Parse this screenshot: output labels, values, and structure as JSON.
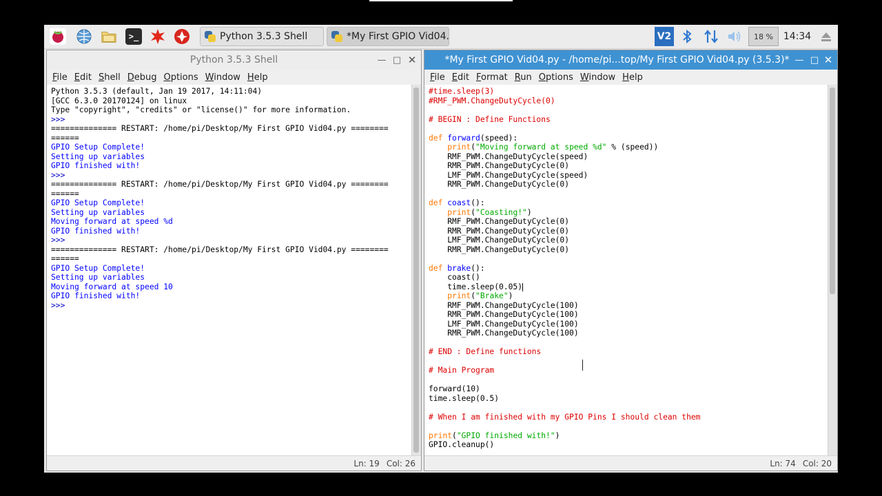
{
  "taskbar": {
    "launchers": [
      "raspberry-menu",
      "web-browser",
      "file-manager",
      "terminal",
      "math-kernel",
      "wolfram"
    ],
    "tasks": [
      {
        "label": "Python 3.5.3 Shell",
        "active": false
      },
      {
        "label": "*My First GPIO Vid04...",
        "active": true
      }
    ],
    "tray": {
      "vnc": "V2",
      "cpu": "18 %",
      "clock": "14:34"
    }
  },
  "shell": {
    "title": "Python 3.5.3 Shell",
    "menus": [
      "File",
      "Edit",
      "Shell",
      "Debug",
      "Options",
      "Window",
      "Help"
    ],
    "lines": [
      {
        "t": "Python 3.5.3 (default, Jan 19 2017, 14:11:04)",
        "c": ""
      },
      {
        "t": "[GCC 6.3.0 20170124] on linux",
        "c": ""
      },
      {
        "t": "Type \"copyright\", \"credits\" or \"license()\" for more information.",
        "c": ""
      },
      {
        "t": ">>> ",
        "c": "c-out"
      },
      {
        "t": "============== RESTART: /home/pi/Desktop/My First GPIO Vid04.py ========",
        "c": ""
      },
      {
        "t": "======",
        "c": ""
      },
      {
        "t": "GPIO Setup Complete!",
        "c": "c-stdout"
      },
      {
        "t": "Setting up variables",
        "c": "c-stdout"
      },
      {
        "t": "GPIO finished with!",
        "c": "c-stdout"
      },
      {
        "t": ">>> ",
        "c": "c-out"
      },
      {
        "t": "============== RESTART: /home/pi/Desktop/My First GPIO Vid04.py ========",
        "c": ""
      },
      {
        "t": "======",
        "c": ""
      },
      {
        "t": "GPIO Setup Complete!",
        "c": "c-stdout"
      },
      {
        "t": "Setting up variables",
        "c": "c-stdout"
      },
      {
        "t": "Moving forward at speed %d",
        "c": "c-stdout"
      },
      {
        "t": "GPIO finished with!",
        "c": "c-stdout"
      },
      {
        "t": ">>> ",
        "c": "c-out"
      },
      {
        "t": "============== RESTART: /home/pi/Desktop/My First GPIO Vid04.py ========",
        "c": ""
      },
      {
        "t": "======",
        "c": ""
      },
      {
        "t": "GPIO Setup Complete!",
        "c": "c-stdout"
      },
      {
        "t": "Setting up variables",
        "c": "c-stdout"
      },
      {
        "t": "Moving forward at speed 10",
        "c": "c-stdout"
      },
      {
        "t": "GPIO finished with!",
        "c": "c-stdout"
      },
      {
        "t": ">>> ",
        "c": "c-out"
      }
    ],
    "status": {
      "ln": "Ln: 19",
      "col": "Col: 26"
    }
  },
  "editor": {
    "title": "*My First GPIO Vid04.py - /home/pi...top/My First GPIO Vid04.py (3.5.3)*",
    "menus": [
      "File",
      "Edit",
      "Format",
      "Run",
      "Options",
      "Window",
      "Help"
    ],
    "lines": [
      [
        {
          "t": "#time.sleep(3)",
          "c": "c-cmt"
        }
      ],
      [
        {
          "t": "#RMF_PWM.ChangeDutyCycle(0)",
          "c": "c-cmt"
        }
      ],
      [],
      [
        {
          "t": "# BEGIN : Define Functions",
          "c": "c-cmt"
        }
      ],
      [],
      [
        {
          "t": "def ",
          "c": "c-def"
        },
        {
          "t": "forward",
          "c": "c-fn"
        },
        {
          "t": "(speed):",
          "c": ""
        }
      ],
      [
        {
          "t": "    ",
          "c": ""
        },
        {
          "t": "print",
          "c": "c-def"
        },
        {
          "t": "(",
          "c": ""
        },
        {
          "t": "\"Moving forward at speed %d\"",
          "c": "c-str"
        },
        {
          "t": " % (speed))",
          "c": ""
        }
      ],
      [
        {
          "t": "    RMF_PWM.ChangeDutyCycle(speed)",
          "c": ""
        }
      ],
      [
        {
          "t": "    RMR_PWM.ChangeDutyCycle(0)",
          "c": ""
        }
      ],
      [
        {
          "t": "    LMF_PWM.ChangeDutyCycle(speed)",
          "c": ""
        }
      ],
      [
        {
          "t": "    RMR_PWM.ChangeDutyCycle(0)",
          "c": ""
        }
      ],
      [],
      [
        {
          "t": "def ",
          "c": "c-def"
        },
        {
          "t": "coast",
          "c": "c-fn"
        },
        {
          "t": "():",
          "c": ""
        }
      ],
      [
        {
          "t": "    ",
          "c": ""
        },
        {
          "t": "print",
          "c": "c-def"
        },
        {
          "t": "(",
          "c": ""
        },
        {
          "t": "\"Coasting!\"",
          "c": "c-str"
        },
        {
          "t": ")",
          "c": ""
        }
      ],
      [
        {
          "t": "    RMF_PWM.ChangeDutyCycle(0)",
          "c": ""
        }
      ],
      [
        {
          "t": "    RMR_PWM.ChangeDutyCycle(0)",
          "c": ""
        }
      ],
      [
        {
          "t": "    LMF_PWM.ChangeDutyCycle(0)",
          "c": ""
        }
      ],
      [
        {
          "t": "    RMR_PWM.ChangeDutyCycle(0)",
          "c": ""
        }
      ],
      [],
      [
        {
          "t": "def ",
          "c": "c-def"
        },
        {
          "t": "brake",
          "c": "c-fn"
        },
        {
          "t": "():",
          "c": ""
        }
      ],
      [
        {
          "t": "    coast()",
          "c": ""
        }
      ],
      [
        {
          "t": "    time.sleep(0.05)",
          "c": ""
        },
        {
          "t": "",
          "c": "cursor"
        }
      ],
      [
        {
          "t": "    ",
          "c": ""
        },
        {
          "t": "print",
          "c": "c-def"
        },
        {
          "t": "(",
          "c": ""
        },
        {
          "t": "\"Brake\"",
          "c": "c-str"
        },
        {
          "t": ")",
          "c": ""
        }
      ],
      [
        {
          "t": "    RMF_PWM.ChangeDutyCycle(100)",
          "c": ""
        }
      ],
      [
        {
          "t": "    RMR_PWM.ChangeDutyCycle(100)",
          "c": ""
        }
      ],
      [
        {
          "t": "    LMF_PWM.ChangeDutyCycle(100)",
          "c": ""
        }
      ],
      [
        {
          "t": "    RMR_PWM.ChangeDutyCycle(100)",
          "c": ""
        }
      ],
      [],
      [
        {
          "t": "# END : Define functions",
          "c": "c-cmt"
        }
      ],
      [],
      [
        {
          "t": "# Main Program",
          "c": "c-cmt"
        }
      ],
      [],
      [
        {
          "t": "forward(10)",
          "c": ""
        }
      ],
      [
        {
          "t": "time.sleep(0.5)",
          "c": ""
        }
      ],
      [],
      [
        {
          "t": "# When I am finished with my GPIO Pins I should clean them",
          "c": "c-cmt"
        }
      ],
      [],
      [
        {
          "t": "print",
          "c": "c-def"
        },
        {
          "t": "(",
          "c": ""
        },
        {
          "t": "\"GPIO finished with!\"",
          "c": "c-str"
        },
        {
          "t": ")",
          "c": ""
        }
      ],
      [
        {
          "t": "GPIO.cleanup()",
          "c": ""
        }
      ]
    ],
    "status": {
      "ln": "Ln: 74",
      "col": "Col: 20"
    }
  },
  "colors": {
    "title_active": "#3f92d2",
    "keyword": "#ff7700",
    "string": "#00aa00",
    "comment": "#dd0000",
    "funcname": "#0000ff"
  }
}
